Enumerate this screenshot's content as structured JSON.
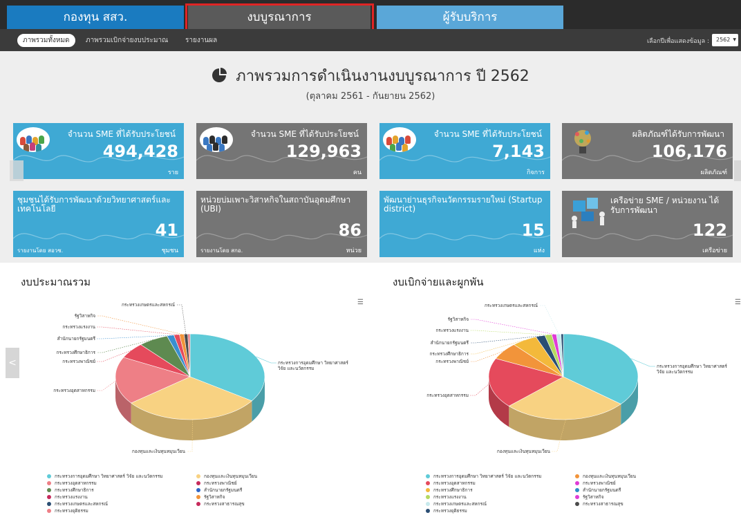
{
  "tabs": [
    "กองทุน สสว.",
    "งบบูรณาการ",
    "ผู้รับบริการ"
  ],
  "subnav": {
    "items": [
      "ภาพรวมทั้งหมด",
      "ภาพรวมเบิกจ่ายงบประมาณ",
      "รายงานผล"
    ],
    "year_label": "เลือกปีเพื่อแสดงข้อมูล :",
    "year_value": "2562"
  },
  "overview": {
    "title": "ภาพรวมการดำเนินงานงบบูรณาการ ปี 2562",
    "subtitle": "(ตุลาคม 2561 - กันยายน 2562)"
  },
  "cards": [
    {
      "title": "จำนวน SME ที่ได้รับประโยชน์",
      "value": "494,428",
      "unit": "ราย",
      "note": ""
    },
    {
      "title": "จำนวน SME ที่ได้รับประโยชน์",
      "value": "129,963",
      "unit": "คน",
      "note": ""
    },
    {
      "title": "จำนวน SME ที่ได้รับประโยชน์",
      "value": "7,143",
      "unit": "กิจการ",
      "note": ""
    },
    {
      "title": "ผลิตภัณฑ์ได้รับการพัฒนา",
      "value": "106,176",
      "unit": "ผลิตภัณฑ์",
      "note": ""
    },
    {
      "title": "ชุมชนได้รับการพัฒนาด้วยวิทยาศาสตร์และเทคโนโลยี",
      "value": "41",
      "unit": "ชุมชน",
      "note": "รายงานโดย สอวช."
    },
    {
      "title": "หน่วยบ่มเพาะวิสาหกิจในสถาบันอุดมศึกษา (UBI)",
      "value": "86",
      "unit": "หน่วย",
      "note": "รายงานโดย สกอ."
    },
    {
      "title": "พัฒนาย่านธุรกิจนวัตกรรมรายใหม่ (Startup district)",
      "value": "15",
      "unit": "แห่ง",
      "note": ""
    },
    {
      "title": "เครือข่าย SME / หน่วยงาน ได้รับการพัฒนา",
      "value": "122",
      "unit": "เครือข่าย",
      "note": ""
    }
  ],
  "colors": {
    "c1": "#5fcbd8",
    "c2": "#f8d282",
    "c3": "#ee7f86",
    "c4": "#e54a5c",
    "c5": "#5e8a50",
    "c6": "#f2943a",
    "c7": "#2f66c7",
    "c8": "#c62a5b",
    "c9": "#f3b93b",
    "c10": "#b6d95f",
    "c11": "#c7e9ec",
    "c12": "#e03bd6",
    "c13": "#2b4e73",
    "c14": "#4b4b4b",
    "c15": "#3a8fd0"
  },
  "chart_data": [
    {
      "type": "pie",
      "title": "งบประมาณรวม",
      "series": [
        {
          "label": "กระทรวงการอุดมศึกษา วิทยาศาสตร์ วิจัย และนวัตกรรม",
          "value": 34.5,
          "color": "#5fcbd8"
        },
        {
          "label": "กองทุนและเงินทุนหมุนเวียน",
          "value": 30.0,
          "color": "#f8d282"
        },
        {
          "label": "กระทรวงอุตสาหกรรม",
          "value": 18.0,
          "color": "#ee7f86"
        },
        {
          "label": "กระทรวงพาณิชย์",
          "value": 6.0,
          "color": "#e54a5c"
        },
        {
          "label": "กระทรวงศึกษาธิการ",
          "value": 6.5,
          "color": "#5e8a50"
        },
        {
          "label": "สำนักนายกรัฐมนตรี",
          "value": 1.5,
          "color": "#3a8fd0"
        },
        {
          "label": "กระทรวงแรงงาน",
          "value": 1.2,
          "color": "#e54a5c"
        },
        {
          "label": "รัฐวิสาหกิจ",
          "value": 1.0,
          "color": "#f2943a"
        },
        {
          "label": "กระทรวงเกษตรและสหกรณ์",
          "value": 0.8,
          "color": "#4b4b4b"
        },
        {
          "label": "กระทรวงยุติธรรม",
          "value": 0.5,
          "color": "#ee7f86"
        }
      ],
      "legend": [
        {
          "label": "กระทรวงการอุดมศึกษา วิทยาศาสตร์ วิจัย และนวัตกรรม",
          "color": "#5fcbd8"
        },
        {
          "label": "กองทุนและเงินทุนหมุนเวียน",
          "color": "#f8d282"
        },
        {
          "label": "กระทรวงอุตสาหกรรม",
          "color": "#ee7f86"
        },
        {
          "label": "กระทรวงพาณิชย์",
          "color": "#c62a5b"
        },
        {
          "label": "กระทรวงศึกษาธิการ",
          "color": "#5e8a50"
        },
        {
          "label": "สำนักนายกรัฐมนตรี",
          "color": "#2f66c7"
        },
        {
          "label": "กระทรวงแรงงาน",
          "color": "#c62a5b"
        },
        {
          "label": "รัฐวิสาหกิจ",
          "color": "#f2943a"
        },
        {
          "label": "กระทรวงเกษตรและสหกรณ์",
          "color": "#2b4e73"
        },
        {
          "label": "กระทรวงสาธารณสุข",
          "color": "#c62a5b"
        },
        {
          "label": "กระทรวงยุติธรรม",
          "color": "#ee7f86"
        }
      ]
    },
    {
      "type": "pie",
      "title": "งบเบิกจ่ายและผูกพัน",
      "series": [
        {
          "label": "กระทรวงการอุดมศึกษา วิทยาศาสตร์ วิจัย และนวัตกรรม",
          "value": 36.0,
          "color": "#5fcbd8"
        },
        {
          "label": "กองทุนและเงินทุนหมุนเวียน",
          "value": 27.0,
          "color": "#f8d282"
        },
        {
          "label": "กระทรวงอุตสาหกรรม",
          "value": 19.0,
          "color": "#e54a5c"
        },
        {
          "label": "กระทรวงพาณิชย์",
          "value": 6.5,
          "color": "#f2943a"
        },
        {
          "label": "กระทรวงศึกษาธิการ",
          "value": 5.5,
          "color": "#f3b93b"
        },
        {
          "label": "สำนักนายกรัฐมนตรี",
          "value": 2.0,
          "color": "#2b4e73"
        },
        {
          "label": "กระทรวงแรงงาน",
          "value": 1.5,
          "color": "#b6d95f"
        },
        {
          "label": "รัฐวิสาหกิจ",
          "value": 1.0,
          "color": "#e03bd6"
        },
        {
          "label": "กระทรวงเกษตรและสหกรณ์",
          "value": 1.0,
          "color": "#c7e9ec"
        },
        {
          "label": "กระทรวงยุติธรรม",
          "value": 0.5,
          "color": "#2b4e73"
        }
      ],
      "legend": [
        {
          "label": "กระทรวงการอุดมศึกษา วิทยาศาสตร์ วิจัย และนวัตกรรม",
          "color": "#5fcbd8"
        },
        {
          "label": "กองทุนและเงินทุนหมุนเวียน",
          "color": "#f2943a"
        },
        {
          "label": "กระทรวงอุตสาหกรรม",
          "color": "#e54a5c"
        },
        {
          "label": "กระทรวงพาณิชย์",
          "color": "#e03bd6"
        },
        {
          "label": "กระทรวงศึกษาธิการ",
          "color": "#f3b93b"
        },
        {
          "label": "สำนักนายกรัฐมนตรี",
          "color": "#2b8fc7"
        },
        {
          "label": "กระทรวงแรงงาน",
          "color": "#b6d95f"
        },
        {
          "label": "รัฐวิสาหกิจ",
          "color": "#e03bd6"
        },
        {
          "label": "กระทรวงเกษตรและสหกรณ์",
          "color": "#c7e9ec"
        },
        {
          "label": "กระทรวงสาธารณสุข",
          "color": "#4b4b4b"
        },
        {
          "label": "กระทรวงยุติธรรม",
          "color": "#2b4e73"
        }
      ]
    }
  ]
}
